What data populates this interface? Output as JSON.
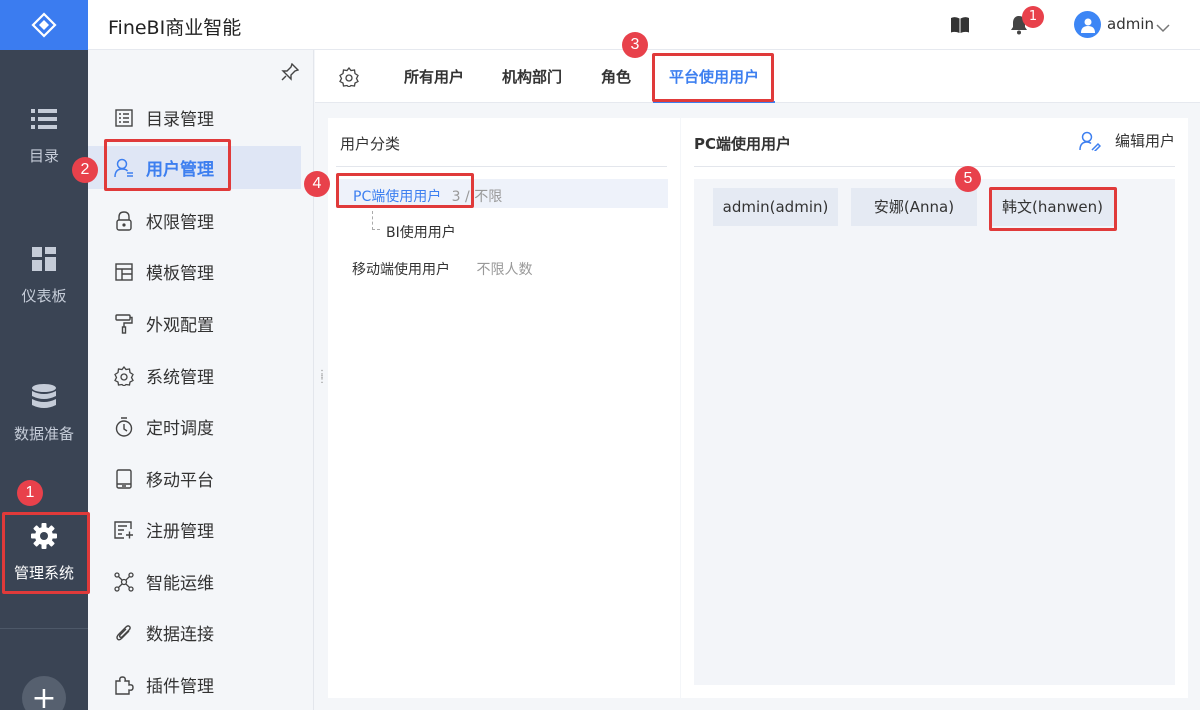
{
  "header": {
    "app_title": "FineBI商业智能",
    "notification_count": "1",
    "username": "admin"
  },
  "left_nav": {
    "items": [
      {
        "label": "目录",
        "icon": "list-icon"
      },
      {
        "label": "仪表板",
        "icon": "dashboard-icon"
      },
      {
        "label": "数据准备",
        "icon": "database-icon"
      },
      {
        "label": "管理系统",
        "icon": "gear-icon",
        "active": true
      }
    ],
    "add_label": "+"
  },
  "menu": {
    "items": [
      {
        "label": "目录管理",
        "icon": "catalog-icon"
      },
      {
        "label": "用户管理",
        "icon": "user-icon",
        "active": true
      },
      {
        "label": "权限管理",
        "icon": "lock-icon"
      },
      {
        "label": "模板管理",
        "icon": "template-icon"
      },
      {
        "label": "外观配置",
        "icon": "paint-roller-icon"
      },
      {
        "label": "系统管理",
        "icon": "settings-icon"
      },
      {
        "label": "定时调度",
        "icon": "timer-icon"
      },
      {
        "label": "移动平台",
        "icon": "mobile-icon"
      },
      {
        "label": "注册管理",
        "icon": "register-icon"
      },
      {
        "label": "智能运维",
        "icon": "network-icon"
      },
      {
        "label": "数据连接",
        "icon": "paperclip-icon"
      },
      {
        "label": "插件管理",
        "icon": "puzzle-icon"
      }
    ]
  },
  "tabs": [
    {
      "label": "所有用户"
    },
    {
      "label": "机构部门"
    },
    {
      "label": "角色"
    },
    {
      "label": "平台使用用户",
      "active": true
    }
  ],
  "categories": {
    "title": "用户分类",
    "rows": [
      {
        "label": "PC端使用用户",
        "count": "3 / 不限",
        "selected": true
      },
      {
        "label": "BI使用用户",
        "count": ""
      },
      {
        "label": "移动端使用用户",
        "count": "不限人数"
      }
    ]
  },
  "user_panel": {
    "title": "PC端使用用户",
    "edit_label": "编辑用户",
    "users": [
      "admin(admin)",
      "安娜(Anna)",
      "韩文(hanwen)"
    ]
  },
  "annotations": [
    "1",
    "2",
    "3",
    "4",
    "5"
  ],
  "colors": {
    "accent": "#3d7ff0",
    "nav_bg": "#3a4454",
    "annotation_red": "#e03a3a"
  }
}
